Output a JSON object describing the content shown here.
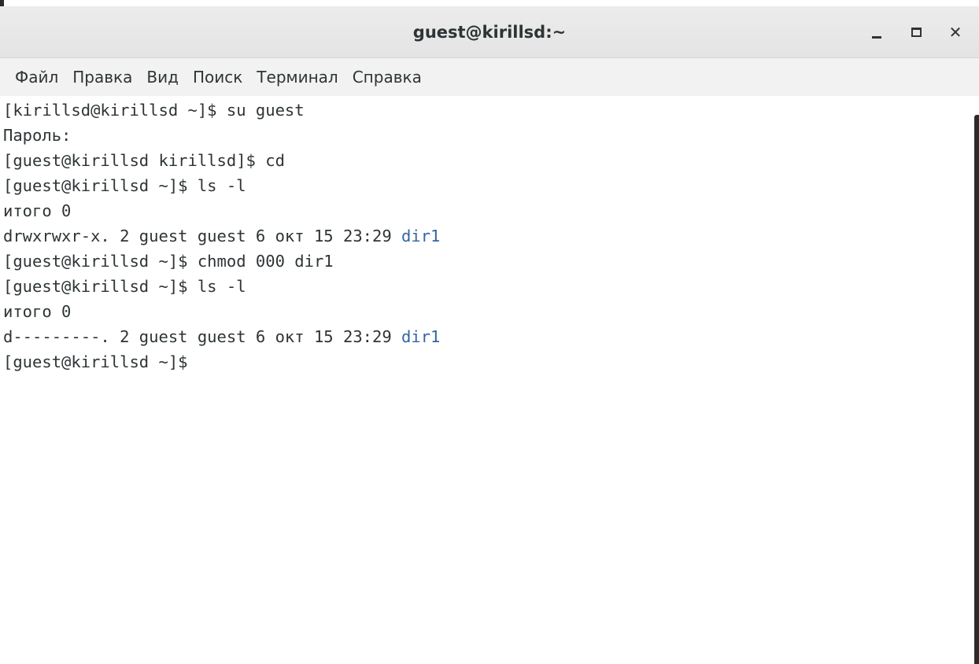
{
  "window": {
    "title": "guest@kirillsd:~",
    "controls": {
      "minimize": "minimize-icon",
      "maximize": "maximize-icon",
      "close": "close-icon"
    }
  },
  "menu": {
    "items": [
      "Файл",
      "Правка",
      "Вид",
      "Поиск",
      "Терминал",
      "Справка"
    ]
  },
  "terminal": {
    "lines": [
      [
        {
          "t": "[kirillsd@kirillsd ~]$ su guest"
        }
      ],
      [
        {
          "t": "Пароль:"
        }
      ],
      [
        {
          "t": "[guest@kirillsd kirillsd]$ cd"
        }
      ],
      [
        {
          "t": "[guest@kirillsd ~]$ ls -l"
        }
      ],
      [
        {
          "t": "итого 0"
        }
      ],
      [
        {
          "t": "drwxrwxr-x. 2 guest guest 6 окт 15 23:29 "
        },
        {
          "t": "dir1",
          "dir": true
        }
      ],
      [
        {
          "t": "[guest@kirillsd ~]$ chmod 000 dir1"
        }
      ],
      [
        {
          "t": "[guest@kirillsd ~]$ ls -l"
        }
      ],
      [
        {
          "t": "итого 0"
        }
      ],
      [
        {
          "t": "d---------. 2 guest guest 6 окт 15 23:29 "
        },
        {
          "t": "dir1",
          "dir": true
        }
      ],
      [
        {
          "t": "[guest@kirillsd ~]$ "
        }
      ]
    ]
  },
  "colors": {
    "foreground": "#2e3436",
    "directory": "#3465a4",
    "background": "#ffffff",
    "titlebar": "#e8e8e8",
    "menubar": "#f2f2f2"
  }
}
